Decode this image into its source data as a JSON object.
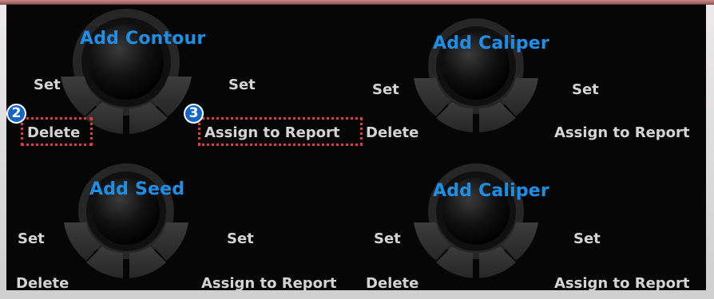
{
  "panels": [
    {
      "title": "Add Contour",
      "set_left": "Set",
      "set_right": "Set",
      "delete": "Delete",
      "assign": "Assign to Report",
      "callout_left_badge": "2",
      "callout_right_badge": "3"
    },
    {
      "title": "Add Caliper",
      "set_left": "Set",
      "set_right": "Set",
      "delete": "Delete",
      "assign": "Assign to Report"
    },
    {
      "title": "Add Seed",
      "set_left": "Set",
      "set_right": "Set",
      "delete": "Delete",
      "assign": "Assign to Report"
    },
    {
      "title": "Add Caliper",
      "set_left": "Set",
      "set_right": "Set",
      "delete": "Delete",
      "assign": "Assign to Report"
    }
  ],
  "colors": {
    "title": "#1f8fe6",
    "label": "#d4d4d4",
    "callout": "#e43b3b",
    "badge": "#1466c8",
    "background": "#060606"
  },
  "icons": [
    "trackball-icon",
    "key-segment-icon"
  ]
}
